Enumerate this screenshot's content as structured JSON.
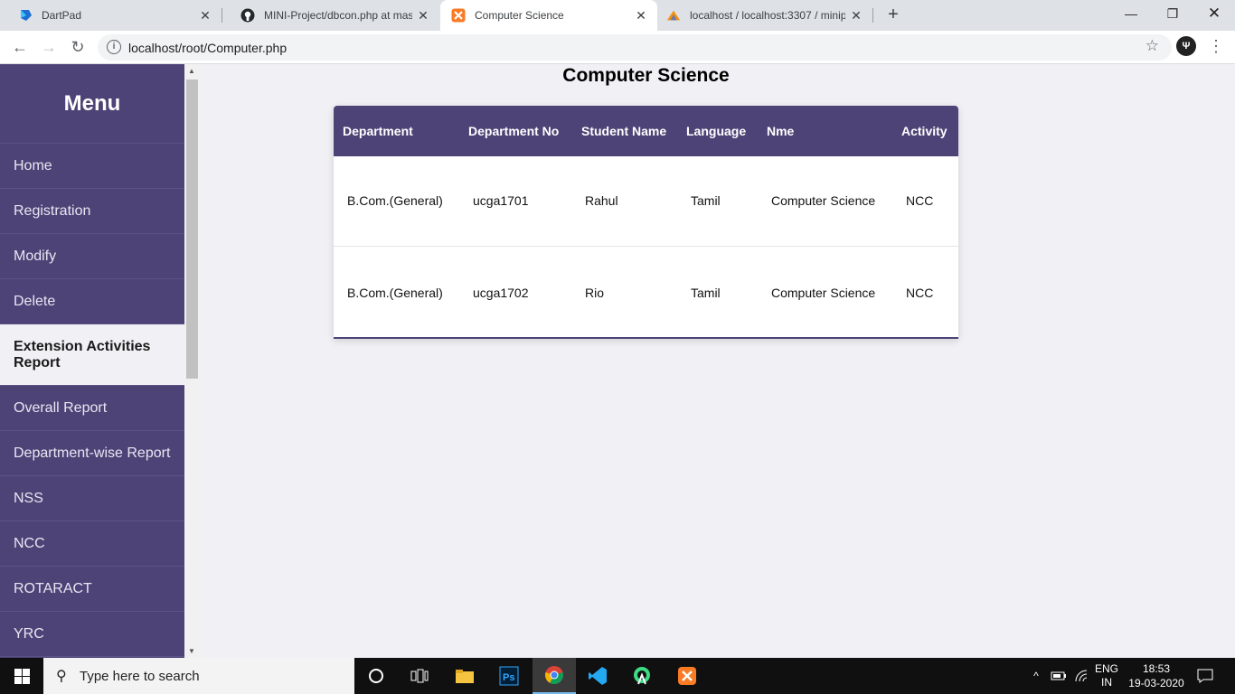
{
  "browser": {
    "tabs": [
      {
        "title": "DartPad",
        "icon": "dartpad-icon"
      },
      {
        "title": "MINI-Project/dbcon.php at maste",
        "icon": "github-icon"
      },
      {
        "title": "Computer Science",
        "icon": "xampp-icon"
      },
      {
        "title": "localhost / localhost:3307 / minip",
        "icon": "phpmyadmin-icon"
      }
    ],
    "url": "localhost/root/Computer.php"
  },
  "sidebar": {
    "title": "Menu",
    "items": [
      {
        "label": "Home"
      },
      {
        "label": "Registration"
      },
      {
        "label": "Modify"
      },
      {
        "label": "Delete"
      },
      {
        "label": "Extension Activities Report"
      },
      {
        "label": "Overall Report"
      },
      {
        "label": "Department-wise Report"
      },
      {
        "label": "NSS"
      },
      {
        "label": "NCC"
      },
      {
        "label": "ROTARACT"
      },
      {
        "label": "YRC"
      }
    ]
  },
  "main": {
    "title": "Computer Science",
    "table": {
      "headers": [
        "Department",
        "Department No",
        "Student Name",
        "Language",
        "Nme",
        "Activity"
      ],
      "rows": [
        [
          "B.Com.(General)",
          "ucga1701",
          "Rahul",
          "Tamil",
          "Computer Science",
          "NCC"
        ],
        [
          "B.Com.(General)",
          "ucga1702",
          "Rio",
          "Tamil",
          "Computer Science",
          "NCC"
        ]
      ]
    }
  },
  "taskbar": {
    "search_placeholder": "Type here to search",
    "language": "ENG",
    "region": "IN",
    "time": "18:53",
    "date": "19-03-2020"
  },
  "colors": {
    "accent": "#4e4376",
    "background": "#f1f1f5"
  }
}
